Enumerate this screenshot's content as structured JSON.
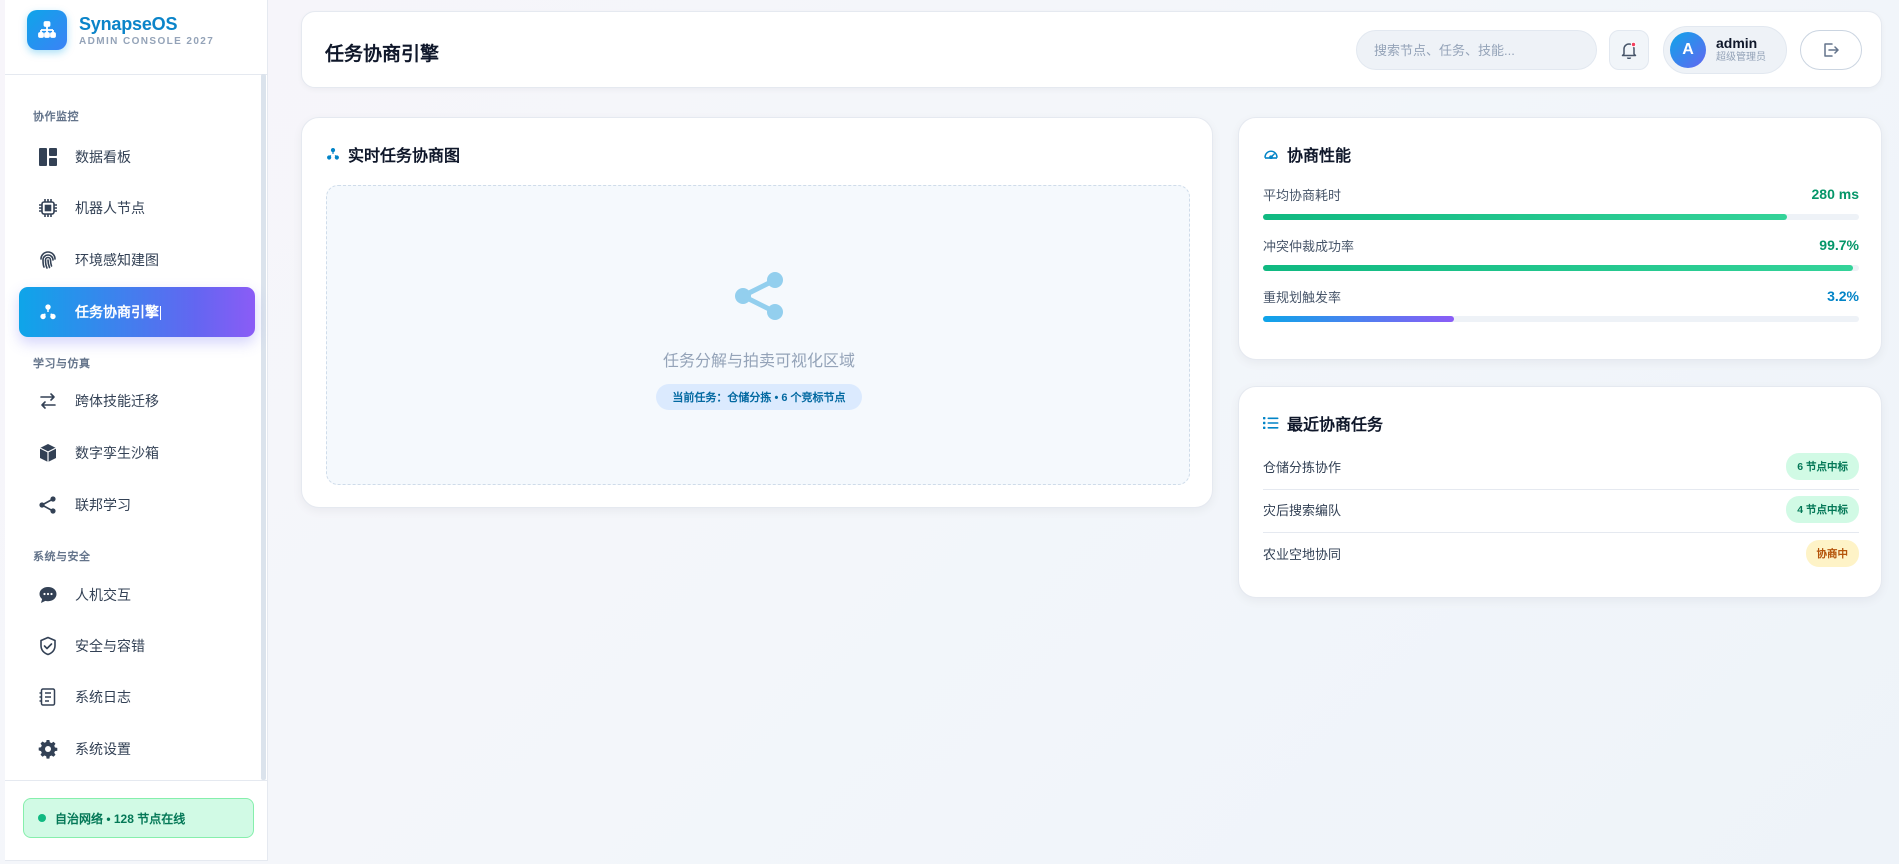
{
  "brand": {
    "name": "SynapseOS",
    "subtitle": "ADMIN CONSOLE 2027"
  },
  "sidebar": {
    "sections": [
      {
        "title": "协作监控"
      },
      {
        "title": "学习与仿真"
      },
      {
        "title": "系统与安全"
      }
    ],
    "items": [
      {
        "label": "数据看板",
        "icon": "dashboard-icon"
      },
      {
        "label": "机器人节点",
        "icon": "chip-icon"
      },
      {
        "label": "环境感知建图",
        "icon": "fingerprint-icon"
      },
      {
        "label": "任务协商引擎",
        "icon": "hierarchy-icon",
        "active": true
      },
      {
        "label": "跨体技能迁移",
        "icon": "arrows-swap-icon"
      },
      {
        "label": "数字孪生沙箱",
        "icon": "cube-icon"
      },
      {
        "label": "联邦学习",
        "icon": "share-nodes-icon"
      },
      {
        "label": "人机交互",
        "icon": "chat-bubble-icon"
      },
      {
        "label": "安全与容错",
        "icon": "shield-icon"
      },
      {
        "label": "系统日志",
        "icon": "log-list-icon"
      },
      {
        "label": "系统设置",
        "icon": "gear-icon"
      }
    ],
    "status": "自治网络 • 128 节点在线"
  },
  "header": {
    "title": "任务协商引擎",
    "search_placeholder": "搜索节点、任务、技能...",
    "user": {
      "initial": "A",
      "name": "admin",
      "role": "超级管理员"
    }
  },
  "graph_card": {
    "title": "实时任务协商图",
    "placeholder": "任务分解与拍卖可视化区域",
    "current_task": "当前任务：仓储分拣 • 6 个竞标节点"
  },
  "perf_card": {
    "title": "协商性能",
    "metrics": [
      {
        "name": "平均协商耗时",
        "value": "280 ms",
        "progress": 0.88,
        "color": "#10b981"
      },
      {
        "name": "冲突仲裁成功率",
        "value": "99.7%",
        "progress": 0.99,
        "color": "#10b981"
      },
      {
        "name": "重规划触发率",
        "value": "3.2%",
        "progress": 0.32,
        "color": "#0ea5e9"
      }
    ]
  },
  "tasks_card": {
    "title": "最近协商任务",
    "tasks": [
      {
        "name": "仓储分拣协作",
        "badge": "6 节点中标",
        "status": "success"
      },
      {
        "name": "灾后搜索编队",
        "badge": "4 节点中标",
        "status": "success"
      },
      {
        "name": "农业空地协同",
        "badge": "协商中",
        "status": "pending"
      }
    ]
  },
  "colors": {
    "accent": "#0ea5e9",
    "accent_end": "#8b5cf6",
    "success": "#10b981",
    "success_bg": "#d1fae5",
    "pending_bg": "#fef3c7",
    "pending_text": "#b45309"
  }
}
